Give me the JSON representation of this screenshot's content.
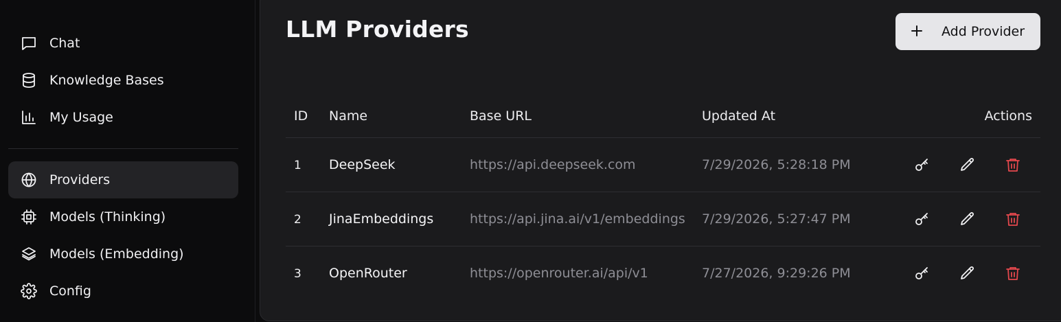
{
  "sidebar": {
    "items": [
      {
        "label": "Chat",
        "icon": "chat-icon"
      },
      {
        "label": "Knowledge Bases",
        "icon": "database-icon"
      },
      {
        "label": "My Usage",
        "icon": "bar-chart-icon"
      },
      {
        "label": "Providers",
        "icon": "globe-icon",
        "active": true
      },
      {
        "label": "Models (Thinking)",
        "icon": "cpu-icon"
      },
      {
        "label": "Models (Embedding)",
        "icon": "layers-icon"
      },
      {
        "label": "Config",
        "icon": "gear-icon"
      }
    ]
  },
  "page": {
    "title": "LLM Providers",
    "add_button_label": "Add Provider"
  },
  "table": {
    "headers": {
      "id": "ID",
      "name": "Name",
      "base_url": "Base URL",
      "updated_at": "Updated At",
      "actions": "Actions"
    },
    "rows": [
      {
        "id": "1",
        "name": "DeepSeek",
        "base_url": "https://api.deepseek.com",
        "updated_at": "7/29/2026, 5:28:18 PM"
      },
      {
        "id": "2",
        "name": "JinaEmbeddings",
        "base_url": "https://api.jina.ai/v1/embeddings",
        "updated_at": "7/29/2026, 5:27:47 PM"
      },
      {
        "id": "3",
        "name": "OpenRouter",
        "base_url": "https://openrouter.ai/api/v1",
        "updated_at": "7/27/2026, 9:29:26 PM"
      }
    ]
  },
  "colors": {
    "background": "#0c0c0d",
    "panel": "#1b1b1d",
    "active_nav": "#232326",
    "button_bg": "#e6e6e9",
    "delete_icon": "#e5484d",
    "muted_text": "#8e8e95"
  }
}
